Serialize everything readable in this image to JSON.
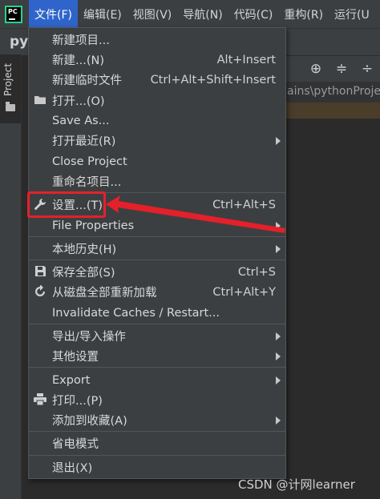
{
  "menubar": {
    "logo_text": "PC",
    "items": [
      "文件(F)",
      "编辑(E)",
      "视图(V)",
      "导航(N)",
      "代码(C)",
      "重构(R)",
      "运行(U"
    ]
  },
  "project_label": "py",
  "side_panel": {
    "tab_label": "Project"
  },
  "editor": {
    "path_fragment": "ains\\pythonProje"
  },
  "file_menu": {
    "items": [
      {
        "label": "新建项目...",
        "shortcut": "",
        "icon": "",
        "submenu": false
      },
      {
        "label": "新建...(N)",
        "shortcut": "Alt+Insert",
        "icon": "",
        "submenu": false
      },
      {
        "label": "新建临时文件",
        "shortcut": "Ctrl+Alt+Shift+Insert",
        "icon": "",
        "submenu": false
      },
      {
        "label": "打开...(O)",
        "shortcut": "",
        "icon": "folder-icon",
        "submenu": false
      },
      {
        "label": "Save As...",
        "shortcut": "",
        "icon": "",
        "submenu": false
      },
      {
        "label": "打开最近(R)",
        "shortcut": "",
        "icon": "",
        "submenu": true
      },
      {
        "label": "Close Project",
        "shortcut": "",
        "icon": "",
        "submenu": false
      },
      {
        "label": "重命名项目...",
        "shortcut": "",
        "icon": "",
        "submenu": false
      },
      {
        "label": "设置...(T)",
        "shortcut": "Ctrl+Alt+S",
        "icon": "wrench-icon",
        "submenu": false
      },
      {
        "label": "File Properties",
        "shortcut": "",
        "icon": "",
        "submenu": true
      },
      {
        "label": "本地历史(H)",
        "shortcut": "",
        "icon": "",
        "submenu": true
      },
      {
        "label": "保存全部(S)",
        "shortcut": "Ctrl+S",
        "icon": "save-icon",
        "submenu": false
      },
      {
        "label": "从磁盘全部重新加载",
        "shortcut": "Ctrl+Alt+Y",
        "icon": "reload-icon",
        "submenu": false
      },
      {
        "label": "Invalidate Caches / Restart...",
        "shortcut": "",
        "icon": "",
        "submenu": false
      },
      {
        "label": "导出/导入操作",
        "shortcut": "",
        "icon": "",
        "submenu": true
      },
      {
        "label": "其他设置",
        "shortcut": "",
        "icon": "",
        "submenu": true
      },
      {
        "label": "Export",
        "shortcut": "",
        "icon": "",
        "submenu": true
      },
      {
        "label": "打印...(P)",
        "shortcut": "",
        "icon": "printer-icon",
        "submenu": false
      },
      {
        "label": "添加到收藏(A)",
        "shortcut": "",
        "icon": "",
        "submenu": true
      },
      {
        "label": "省电模式",
        "shortcut": "",
        "icon": "",
        "submenu": false
      },
      {
        "label": "退出(X)",
        "shortcut": "",
        "icon": "",
        "submenu": false
      }
    ]
  },
  "watermark": "CSDN @计网learner",
  "colors": {
    "menu_bg": "#3c3f41",
    "active_menu": "#2f65ca",
    "annotation_red": "#e5202a"
  }
}
